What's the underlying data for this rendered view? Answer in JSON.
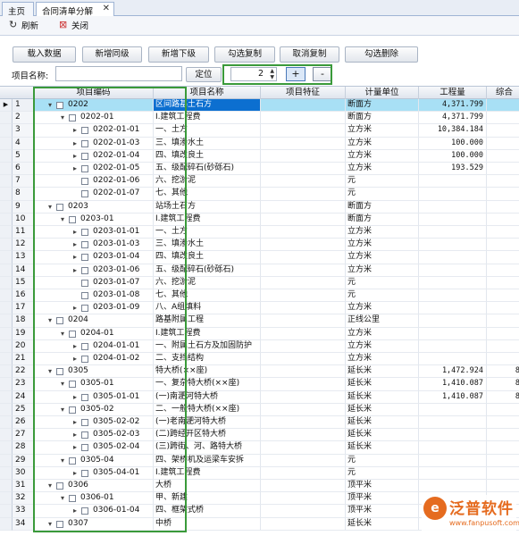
{
  "tabs": [
    {
      "label": "主页"
    },
    {
      "label": "合同清单分解",
      "close": "✕"
    }
  ],
  "toolbar": {
    "refresh": "刷新",
    "close": "关闭"
  },
  "buttons": [
    "载入数据",
    "新增同级",
    "新增下级",
    "勾选复制",
    "取消复制",
    "勾选删除"
  ],
  "search": {
    "label": "项目名称:",
    "value": "",
    "locate": "定位",
    "level": "2",
    "plus": "+",
    "minus": "-"
  },
  "columns": [
    "项目编码",
    "项目名称",
    "项目特征",
    "计量单位",
    "工程量",
    "综合"
  ],
  "rows": [
    {
      "n": "1",
      "lv": 0,
      "exp": "▾",
      "code": "0202",
      "name": "区间路基土石方",
      "unit": "断面方",
      "qty": "4,371.799",
      "tot": ""
    },
    {
      "n": "2",
      "lv": 1,
      "exp": "▾",
      "code": "0202-01",
      "name": "Ⅰ.建筑工程费",
      "unit": "断面方",
      "qty": "4,371.799",
      "tot": ""
    },
    {
      "n": "3",
      "lv": 2,
      "exp": "▸",
      "code": "0202-01-01",
      "name": "一、土方",
      "unit": "立方米",
      "qty": "10,384.184",
      "tot": ""
    },
    {
      "n": "4",
      "lv": 2,
      "exp": "▸",
      "code": "0202-01-03",
      "name": "三、填渗水土",
      "unit": "立方米",
      "qty": "100.000",
      "tot": ""
    },
    {
      "n": "5",
      "lv": 2,
      "exp": "▸",
      "code": "0202-01-04",
      "name": "四、填改良土",
      "unit": "立方米",
      "qty": "100.000",
      "tot": ""
    },
    {
      "n": "6",
      "lv": 2,
      "exp": "▸",
      "code": "0202-01-05",
      "name": "五、级配碎石(砂砾石)",
      "unit": "立方米",
      "qty": "193.529",
      "tot": ""
    },
    {
      "n": "7",
      "lv": 2,
      "exp": "",
      "code": "0202-01-06",
      "name": "六、挖淤泥",
      "unit": "元",
      "qty": "",
      "tot": ""
    },
    {
      "n": "8",
      "lv": 2,
      "exp": "",
      "code": "0202-01-07",
      "name": "七、其他",
      "unit": "元",
      "qty": "",
      "tot": ""
    },
    {
      "n": "9",
      "lv": 0,
      "exp": "▾",
      "code": "0203",
      "name": "站场土石方",
      "unit": "断面方",
      "qty": "",
      "tot": ""
    },
    {
      "n": "10",
      "lv": 1,
      "exp": "▾",
      "code": "0203-01",
      "name": "Ⅰ.建筑工程费",
      "unit": "断面方",
      "qty": "",
      "tot": ""
    },
    {
      "n": "11",
      "lv": 2,
      "exp": "▸",
      "code": "0203-01-01",
      "name": "一、土方",
      "unit": "立方米",
      "qty": "",
      "tot": ""
    },
    {
      "n": "12",
      "lv": 2,
      "exp": "▸",
      "code": "0203-01-03",
      "name": "三、填渗水土",
      "unit": "立方米",
      "qty": "",
      "tot": ""
    },
    {
      "n": "13",
      "lv": 2,
      "exp": "▸",
      "code": "0203-01-04",
      "name": "四、填改良土",
      "unit": "立方米",
      "qty": "",
      "tot": ""
    },
    {
      "n": "14",
      "lv": 2,
      "exp": "▸",
      "code": "0203-01-06",
      "name": "五、级配碎石(砂砾石)",
      "unit": "立方米",
      "qty": "",
      "tot": ""
    },
    {
      "n": "15",
      "lv": 2,
      "exp": "",
      "code": "0203-01-07",
      "name": "六、挖淤泥",
      "unit": "元",
      "qty": "",
      "tot": ""
    },
    {
      "n": "16",
      "lv": 2,
      "exp": "",
      "code": "0203-01-08",
      "name": "七、其他",
      "unit": "元",
      "qty": "",
      "tot": ""
    },
    {
      "n": "17",
      "lv": 2,
      "exp": "▸",
      "code": "0203-01-09",
      "name": "八、A组填料",
      "unit": "立方米",
      "qty": "",
      "tot": ""
    },
    {
      "n": "18",
      "lv": 0,
      "exp": "▾",
      "code": "0204",
      "name": "路基附属工程",
      "unit": "正线公里",
      "qty": "",
      "tot": ""
    },
    {
      "n": "19",
      "lv": 1,
      "exp": "▾",
      "code": "0204-01",
      "name": "Ⅰ.建筑工程费",
      "unit": "立方米",
      "qty": "",
      "tot": ""
    },
    {
      "n": "20",
      "lv": 2,
      "exp": "▸",
      "code": "0204-01-01",
      "name": "一、附属土石方及加固防护",
      "unit": "立方米",
      "qty": "",
      "tot": ""
    },
    {
      "n": "21",
      "lv": 2,
      "exp": "▸",
      "code": "0204-01-02",
      "name": "二、支挡结构",
      "unit": "立方米",
      "qty": "",
      "tot": ""
    },
    {
      "n": "22",
      "lv": 0,
      "exp": "▾",
      "code": "0305",
      "name": "特大桥(××座)",
      "unit": "延长米",
      "qty": "1,472.924",
      "tot": "8"
    },
    {
      "n": "23",
      "lv": 1,
      "exp": "▾",
      "code": "0305-01",
      "name": "一、复杂特大桥(××座)",
      "unit": "延长米",
      "qty": "1,410.087",
      "tot": "8"
    },
    {
      "n": "24",
      "lv": 2,
      "exp": "▸",
      "code": "0305-01-01",
      "name": "(一)南淝河特大桥",
      "unit": "延长米",
      "qty": "1,410.087",
      "tot": "8"
    },
    {
      "n": "25",
      "lv": 1,
      "exp": "▾",
      "code": "0305-02",
      "name": "二、一般特大桥(××座)",
      "unit": "延长米",
      "qty": "",
      "tot": ""
    },
    {
      "n": "26",
      "lv": 2,
      "exp": "▸",
      "code": "0305-02-02",
      "name": "(一)老南淝河特大桥",
      "unit": "延长米",
      "qty": "",
      "tot": ""
    },
    {
      "n": "27",
      "lv": 2,
      "exp": "▸",
      "code": "0305-02-03",
      "name": "(二)跨经开区特大桥",
      "unit": "延长米",
      "qty": "",
      "tot": ""
    },
    {
      "n": "28",
      "lv": 2,
      "exp": "▸",
      "code": "0305-02-04",
      "name": "(三)跨街、河、路特大桥",
      "unit": "延长米",
      "qty": "",
      "tot": ""
    },
    {
      "n": "29",
      "lv": 1,
      "exp": "▾",
      "code": "0305-04",
      "name": "四、架桥机及运梁车安拆",
      "unit": "元",
      "qty": "",
      "tot": ""
    },
    {
      "n": "30",
      "lv": 2,
      "exp": "▸",
      "code": "0305-04-01",
      "name": "Ⅰ.建筑工程费",
      "unit": "元",
      "qty": "",
      "tot": ""
    },
    {
      "n": "31",
      "lv": 0,
      "exp": "▾",
      "code": "0306",
      "name": "大桥",
      "unit": "顶平米",
      "qty": "",
      "tot": ""
    },
    {
      "n": "32",
      "lv": 1,
      "exp": "▾",
      "code": "0306-01",
      "name": "甲、新建",
      "unit": "顶平米",
      "qty": "",
      "tot": ""
    },
    {
      "n": "33",
      "lv": 2,
      "exp": "▸",
      "code": "0306-01-04",
      "name": "四、框架式桥",
      "unit": "顶平米",
      "qty": "",
      "tot": ""
    },
    {
      "n": "34",
      "lv": 0,
      "exp": "▾",
      "code": "0307",
      "name": "中桥",
      "unit": "延长米",
      "qty": "",
      "tot": ""
    }
  ],
  "logo": {
    "brand": "泛普软件",
    "url": "www.fanpusoft.com",
    "mark": "e"
  }
}
